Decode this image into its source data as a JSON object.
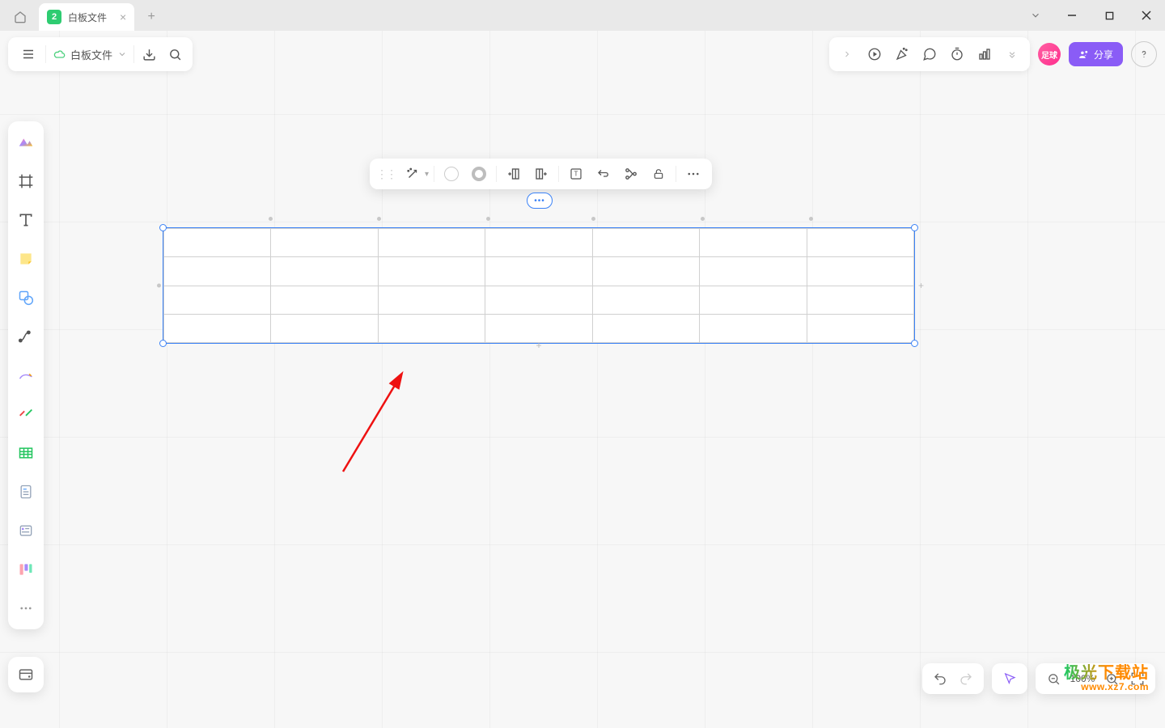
{
  "window": {
    "tab_icon_text": "2",
    "tab_title": "白板文件",
    "file_name": "白板文件"
  },
  "toolbarLeft": {
    "menu": "≡",
    "cloud": "☁",
    "dropdown": "⌄",
    "export": "⇩",
    "search": "🔍"
  },
  "toolbarRight": {
    "avatar_text": "足球",
    "share_label": "分享"
  },
  "zoom": {
    "value": "100%"
  },
  "watermark": {
    "line1": "极光下载站",
    "line2": "www.xz7.com"
  },
  "table": {
    "rows": 4,
    "cols": 7
  },
  "colors": {
    "accent": "#8a5cf6",
    "selection": "#3b82f6",
    "avatar": "#ff2e8e"
  }
}
